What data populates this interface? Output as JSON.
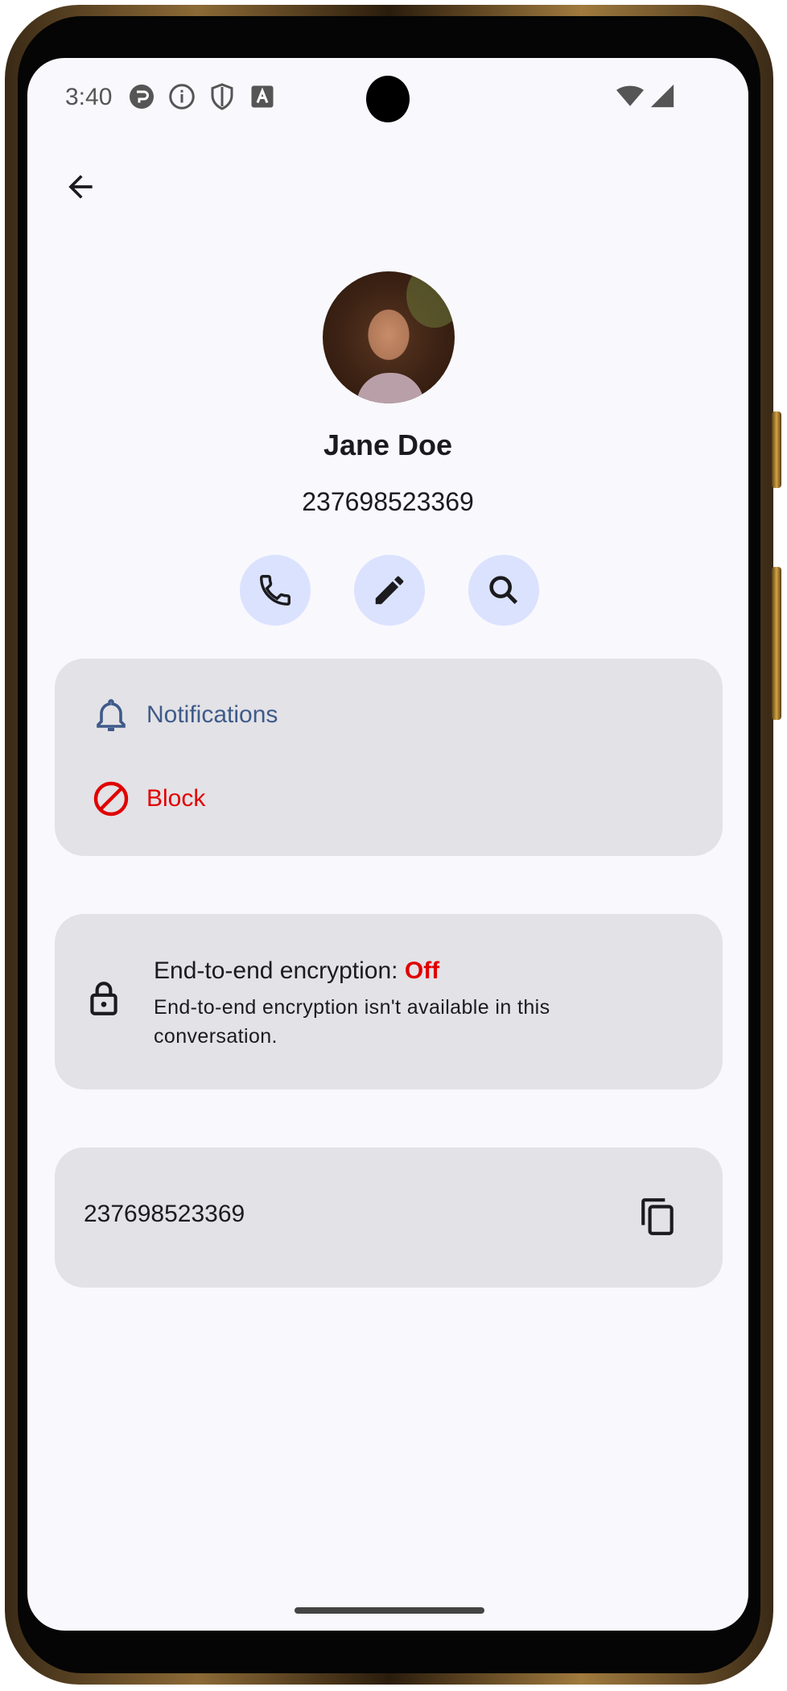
{
  "status_bar": {
    "time": "3:40",
    "left_icons": [
      "message-badge-icon",
      "info-icon",
      "shield-icon",
      "keyboard-a-icon"
    ],
    "right_icons": [
      "wifi-icon",
      "cell-signal-icon"
    ]
  },
  "header": {
    "back_icon": "arrow-back-icon"
  },
  "contact": {
    "name": "Jane Doe",
    "number": "237698523369"
  },
  "actions": [
    {
      "name": "call",
      "icon": "phone-icon"
    },
    {
      "name": "edit",
      "icon": "pencil-icon"
    },
    {
      "name": "search",
      "icon": "search-icon"
    }
  ],
  "options": {
    "notifications_label": "Notifications",
    "block_label": "Block"
  },
  "encryption": {
    "title_prefix": "End-to-end encryption: ",
    "status": "Off",
    "description": "End-to-end encryption isn't available in this conversation."
  },
  "number_card": {
    "value": "237698523369"
  },
  "colors": {
    "accent_blue": "#3f5a8a",
    "danger_red": "#e00000",
    "card_bg": "#e3e2e6",
    "action_bg": "#dae2fe"
  }
}
